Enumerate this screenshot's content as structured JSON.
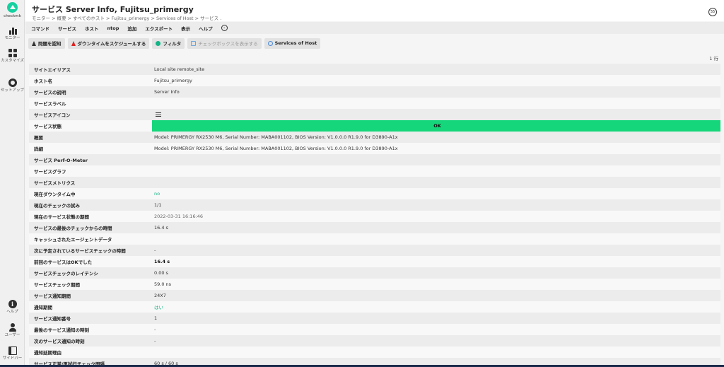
{
  "sidebar": {
    "logo_text": "checkmk",
    "items": [
      {
        "label": "モニター",
        "icon": "bar-chart-icon"
      },
      {
        "label": "カスタマイズ",
        "icon": "grid-icon"
      },
      {
        "label": "セットアップ",
        "icon": "gear-icon"
      }
    ],
    "bottom_items": [
      {
        "label": "ヘルプ",
        "icon": "info-icon"
      },
      {
        "label": "ユーザー",
        "icon": "user-icon"
      },
      {
        "label": "サイドバー",
        "icon": "sidebar-icon"
      }
    ]
  },
  "header": {
    "title": "サービス Server Info, Fujitsu_primergy",
    "breadcrumb": "モニター > 概要 > すべてのホスト > Fujitsu_primergy > Services of Host > サービス .",
    "refresh_value": "55"
  },
  "menu": {
    "items": [
      "コマンド",
      "サービス",
      "ホスト",
      "ntop",
      "追加",
      "エクスポート",
      "表示",
      "ヘルプ"
    ]
  },
  "toolbar": {
    "ack": "問題を認知",
    "downtime": "ダウンタイムをスケジュールする",
    "filter": "フィルタ",
    "checkboxes": "チェックボックスを表示する",
    "services_of_host": "Services of Host"
  },
  "row_count": "1 行",
  "rows": [
    {
      "k": "サイトエイリアス",
      "v": "Local site remote_site"
    },
    {
      "k": "ホスト名",
      "v": "Fujitsu_primergy"
    },
    {
      "k": "サービスの説明",
      "v": "Server Info"
    },
    {
      "k": "サービスラベル",
      "v": ""
    },
    {
      "k": "サービスアイコン",
      "v": ""
    },
    {
      "k": "サービス状態",
      "v": "OK"
    },
    {
      "k": "概要",
      "v": "Model: PRIMERGY RX2530 M6, Serial Number: MABA001102, BIOS Version: V1.0.0.0 R1.9.0 for D3890-A1x"
    },
    {
      "k": "詳細",
      "v": "Model: PRIMERGY RX2530 M6, Serial Number: MABA001102, BIOS Version: V1.0.0.0 R1.9.0 for D3890-A1x"
    },
    {
      "k": "サービス Perf-O-Meter",
      "v": ""
    },
    {
      "k": "サービスグラフ",
      "v": ""
    },
    {
      "k": "サービスメトリクス",
      "v": ""
    },
    {
      "k": "現在ダウンタイム中",
      "v": "no"
    },
    {
      "k": "現在のチェックの試み",
      "v": "1/1"
    },
    {
      "k": "現在のサービス状態の期間",
      "v": "2022-03-31 16:16:46"
    },
    {
      "k": "サービスの最後のチェックからの時間",
      "v": "16.4 s"
    },
    {
      "k": "キャッシュされたエージェントデータ",
      "v": ""
    },
    {
      "k": "次に予定されているサービスチェックの時間",
      "v": "-"
    },
    {
      "k": "前回のサービスはOKでした",
      "v": "16.4 s"
    },
    {
      "k": "サービスチェックのレイテンシ",
      "v": "0.00 s"
    },
    {
      "k": "サービスチェック期間",
      "v": "59.0 ns"
    },
    {
      "k": "サービス通知期間",
      "v": "24X7"
    },
    {
      "k": "通知期間",
      "v": "はい"
    },
    {
      "k": "サービス通知番号",
      "v": "1"
    },
    {
      "k": "最後のサービス通知の時刻",
      "v": "-"
    },
    {
      "k": "次のサービス通知の時刻",
      "v": "-"
    },
    {
      "k": "通知延期理由",
      "v": ""
    },
    {
      "k": "サービス正常/再試行チェック間隔",
      "v": "60 s / 60 s"
    }
  ],
  "colors": {
    "ok": "#15d67a",
    "accent": "#13b386"
  }
}
